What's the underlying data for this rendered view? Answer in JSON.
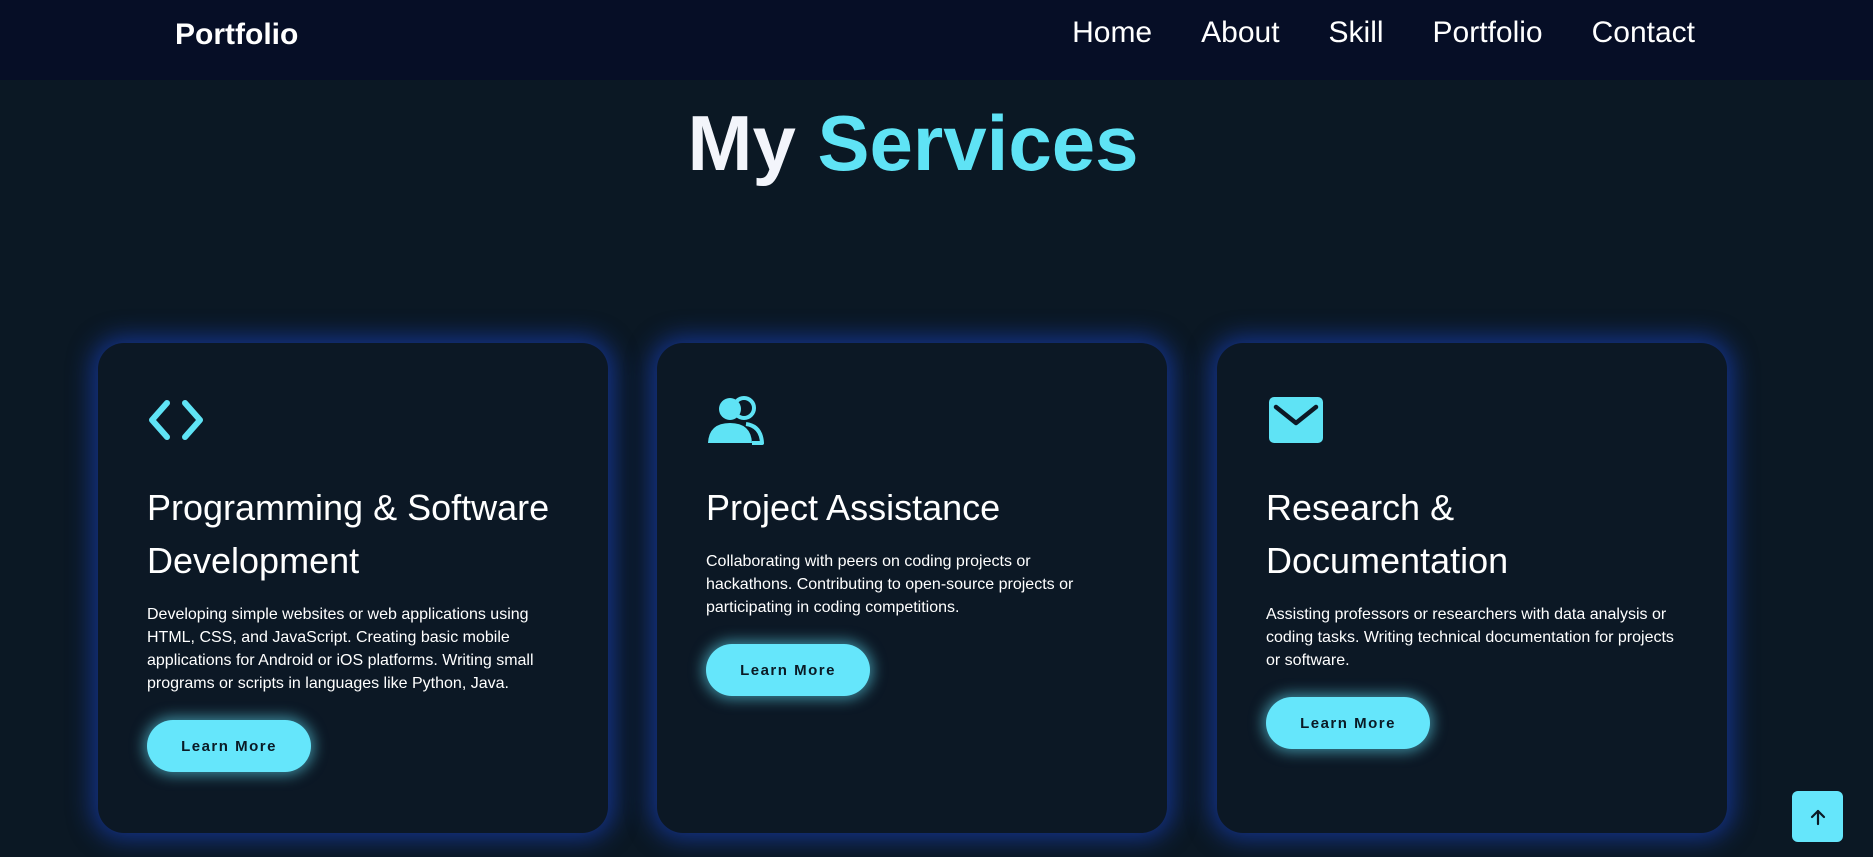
{
  "navbar": {
    "logo": "Portfolio",
    "links": [
      "Home",
      "About",
      "Skill",
      "Portfolio",
      "Contact"
    ]
  },
  "section": {
    "title_main": "My",
    "title_accent": "Services"
  },
  "cards": [
    {
      "icon": "code-icon",
      "title": "Programming & Software Development",
      "description": "Developing simple websites or web applications using HTML, CSS, and JavaScript. Creating basic mobile applications for Android or iOS platforms. Writing small programs or scripts in languages like Python, Java.",
      "button": "Learn More"
    },
    {
      "icon": "users-icon",
      "title": "Project Assistance",
      "description": "Collaborating with peers on coding projects or hackathons. Contributing to open-source projects or participating in coding competitions.",
      "button": "Learn More"
    },
    {
      "icon": "envelope-icon",
      "title": "Research & Documentation",
      "description": "Assisting professors or researchers with data analysis or coding tasks. Writing technical documentation for projects or software.",
      "button": "Learn More"
    }
  ],
  "colors": {
    "accent": "#5fe3f5",
    "background": "#0b1824",
    "navbar": "#060e26",
    "button": "#65e6fb"
  },
  "scroll_top": {
    "icon": "arrow-up-icon"
  }
}
